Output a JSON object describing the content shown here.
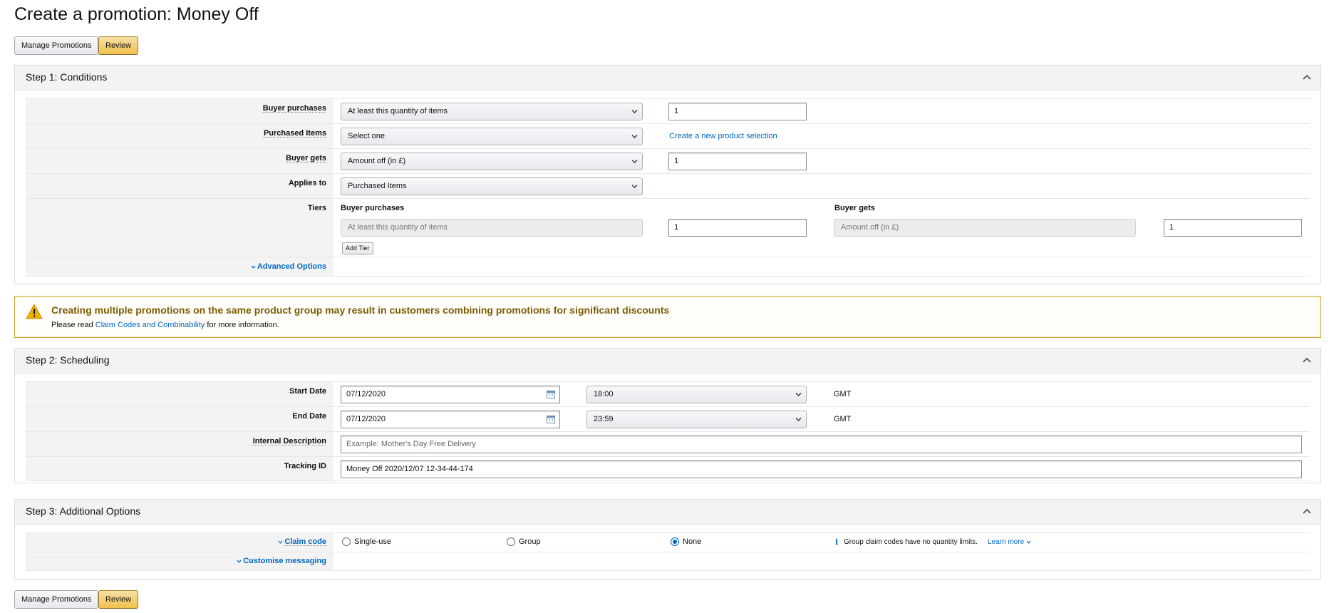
{
  "page": {
    "title": "Create a promotion: Money Off"
  },
  "top_actions": {
    "manage_label": "Manage Promotions",
    "review_label": "Review"
  },
  "bottom_actions": {
    "manage_label": "Manage Promotions",
    "review_label": "Review"
  },
  "step1": {
    "title": "Step 1: Conditions",
    "buyer_purchases": {
      "label": "Buyer purchases",
      "select_value": "At least this quantity of items",
      "input_value": "1"
    },
    "purchased_items": {
      "label": "Purchased Items",
      "select_value": "Select one",
      "link": "Create a new product selection"
    },
    "buyer_gets": {
      "label": "Buyer gets",
      "select_value": "Amount off (in £)",
      "input_value": "1"
    },
    "applies_to": {
      "label": "Applies to",
      "select_value": "Purchased Items"
    },
    "tiers": {
      "label": "Tiers",
      "col_buyer_purchases": "Buyer purchases",
      "col_buyer_gets": "Buyer gets",
      "purchase_select": "At least this quantity of items",
      "purchase_value": "1",
      "gets_select": "Amount off (in £)",
      "gets_value": "1",
      "add_tier_label": "Add Tier"
    },
    "advanced_options": "Advanced Options"
  },
  "alert": {
    "title": "Creating multiple promotions on the same product group may result in customers combining promotions for significant discounts",
    "body_prefix": "Please read",
    "body_link": "Claim Codes and Combinability",
    "body_suffix": "for more information.",
    "accent_color": "#c9a13a"
  },
  "step2": {
    "title": "Step 2: Scheduling",
    "start_date": {
      "label": "Start Date",
      "date": "07/12/2020",
      "time": "18:00",
      "tz": "GMT"
    },
    "end_date": {
      "label": "End Date",
      "date": "07/12/2020",
      "time": "23:59",
      "tz": "GMT"
    },
    "internal_description": {
      "label": "Internal Description",
      "placeholder": "Example: Mother's Day Free Delivery"
    },
    "tracking_id": {
      "label": "Tracking ID",
      "value": "Money Off 2020/12/07 12-34-44-174"
    }
  },
  "step3": {
    "title": "Step 3: Additional Options",
    "claim_code": {
      "label": "Claim code",
      "options": [
        "Single-use",
        "Group",
        "None"
      ],
      "selected": "None",
      "info_text": "Group claim codes have no quantity limits.",
      "learn_more": "Learn more"
    },
    "customise_messaging": "Customise messaging"
  },
  "colors": {
    "primary_button": "#f0c14b",
    "link": "#0066c0",
    "warning_title": "#7c5b00"
  }
}
